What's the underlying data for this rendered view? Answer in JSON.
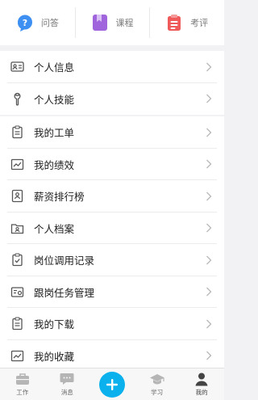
{
  "shortcuts": [
    {
      "label": "问答",
      "icon": "question-bubble-icon",
      "color": "#3d8ff2"
    },
    {
      "label": "课程",
      "icon": "course-book-icon",
      "color": "#a064dc"
    },
    {
      "label": "考评",
      "icon": "evaluation-clipboard-icon",
      "color": "#ef5a5a"
    }
  ],
  "profile_items": [
    {
      "label": "个人信息",
      "icon": "id-card-icon"
    },
    {
      "label": "个人技能",
      "icon": "wrench-icon"
    }
  ],
  "menu_items": [
    {
      "label": "我的工单",
      "icon": "clipboard-icon"
    },
    {
      "label": "我的绩效",
      "icon": "trend-chart-icon"
    },
    {
      "label": "薪资排行榜",
      "icon": "ranking-badge-icon"
    },
    {
      "label": "个人档案",
      "icon": "folder-user-icon"
    },
    {
      "label": "岗位调用记录",
      "icon": "clipboard-check-icon"
    },
    {
      "label": "跟岗任务管理",
      "icon": "task-settings-icon"
    },
    {
      "label": "我的下载",
      "icon": "download-doc-icon"
    },
    {
      "label": "我的收藏",
      "icon": "favorites-chart-icon"
    }
  ],
  "tabbar": {
    "work": "工作",
    "messages": "消息",
    "add": "add-icon",
    "study": "学习",
    "mine": "我的"
  },
  "colors": {
    "accent": "#0bb1ec",
    "icon_gray": "#555555",
    "tab_icon_gray": "#b5b5b5"
  }
}
